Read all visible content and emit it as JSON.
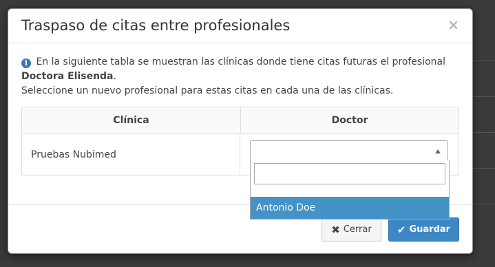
{
  "modal": {
    "title": "Traspaso de citas entre profesionales",
    "close_glyph": "×",
    "info_icon": "i",
    "info_text": "En la siguiente tabla se muestran las clínicas donde tiene citas futuras el profesional",
    "professional_name": "Doctora Elisenda",
    "info_suffix": ".",
    "instruction": "Seleccione un nuevo profesional para estas citas en cada una de las clínicas."
  },
  "table": {
    "headers": [
      "Clínica",
      "Doctor"
    ],
    "rows": [
      {
        "clinic": "Pruebas Nubimed",
        "doctor_selected": ""
      }
    ]
  },
  "dropdown": {
    "search_value": "",
    "search_placeholder": "",
    "options": [
      "Antonio Doe"
    ],
    "highlighted": "Antonio Doe"
  },
  "footer": {
    "cancel_label": "Cerrar",
    "cancel_icon": "✖",
    "save_label": "Guardar",
    "save_icon": "✔"
  },
  "colors": {
    "primary": "#3d87c4",
    "highlight": "#4592c6",
    "info_icon": "#3478bd"
  }
}
